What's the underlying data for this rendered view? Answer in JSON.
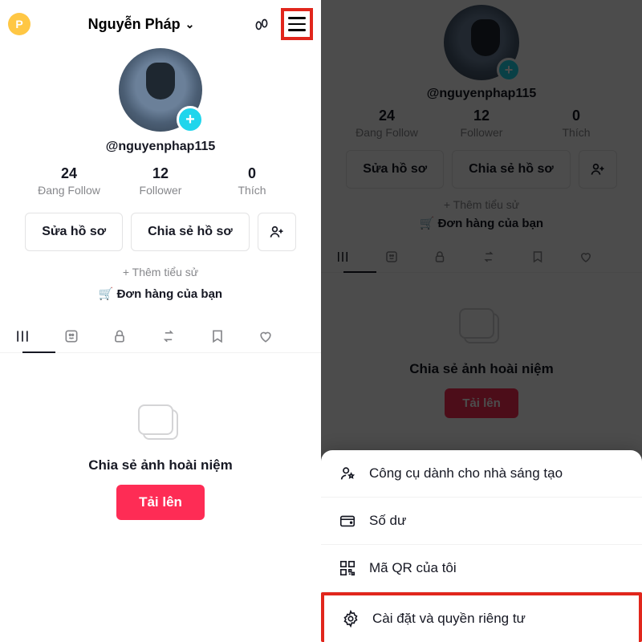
{
  "left": {
    "coin_letter": "P",
    "title": "Nguyễn Pháp",
    "handle": "@nguyenphap115",
    "stats": {
      "following_num": "24",
      "following_lbl": "Đang Follow",
      "followers_num": "12",
      "followers_lbl": "Follower",
      "likes_num": "0",
      "likes_lbl": "Thích"
    },
    "edit_btn": "Sửa hồ sơ",
    "share_btn": "Chia sẻ hồ sơ",
    "add_bio": "+ Thêm tiểu sử",
    "orders": "Đơn hàng của bạn",
    "empty_text": "Chia sẻ ảnh hoài niệm",
    "upload_btn": "Tải lên"
  },
  "right": {
    "handle": "@nguyenphap115",
    "stats": {
      "following_num": "24",
      "following_lbl": "Đang Follow",
      "followers_num": "12",
      "followers_lbl": "Follower",
      "likes_num": "0",
      "likes_lbl": "Thích"
    },
    "edit_btn": "Sửa hồ sơ",
    "share_btn": "Chia sẻ hồ sơ",
    "add_bio": "+ Thêm tiểu sử",
    "orders": "Đơn hàng của bạn",
    "empty_text": "Chia sẻ ảnh hoài niệm",
    "upload_btn": "Tải lên",
    "sheet": {
      "creator_tools": "Công cụ dành cho nhà sáng tạo",
      "balance": "Số dư",
      "qr": "Mã QR của tôi",
      "settings": "Cài đặt và quyền riêng tư"
    }
  }
}
